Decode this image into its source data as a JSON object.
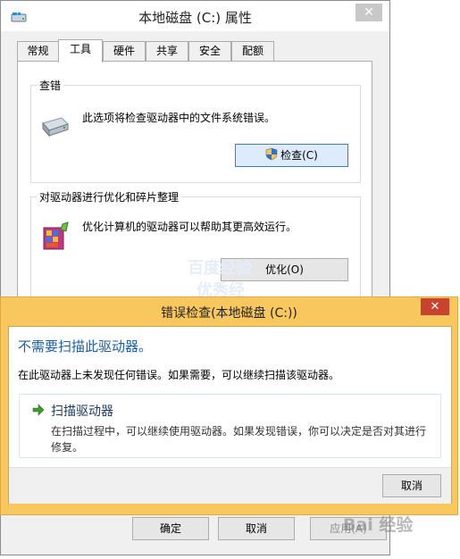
{
  "properties_window": {
    "title": "本地磁盘 (C:) 属性",
    "close_glyph": "✕",
    "tabs": [
      "常规",
      "工具",
      "硬件",
      "共享",
      "安全",
      "配额"
    ],
    "active_tab": "工具",
    "error_checking": {
      "group_title": "查错",
      "description": "此选项将检查驱动器中的文件系统错误。",
      "button_label": "检查(C)",
      "icon": "drive-icon"
    },
    "optimize": {
      "group_title": "对驱动器进行优化和碎片整理",
      "description": "优化计算机的驱动器可以帮助其更高效运行。",
      "button_label": "优化(O)",
      "icon": "defrag-icon"
    },
    "buttons": {
      "ok": "确定",
      "cancel": "取消",
      "apply": "应用(A)"
    }
  },
  "error_check_dialog": {
    "title": "错误检查(本地磁盘 (C:))",
    "close_glyph": "✕",
    "heading": "不需要扫描此驱动器。",
    "message": "在此驱动器上未发现任何错误。如果需要，可以继续扫描该驱动器。",
    "scan_option": {
      "title": "扫描驱动器",
      "description": "在扫描过程中，可以继续使用驱动器。如果发现错误，你可以决定是否对其进行修复。",
      "icon": "green-arrow-icon"
    },
    "cancel_button": "取消",
    "accent_color": "#f8c85e",
    "close_color": "#c7432e"
  },
  "watermark": {
    "center_text_1": "百度经验",
    "center_text_2": "优秀经",
    "corner_text": "Bai 经验"
  }
}
